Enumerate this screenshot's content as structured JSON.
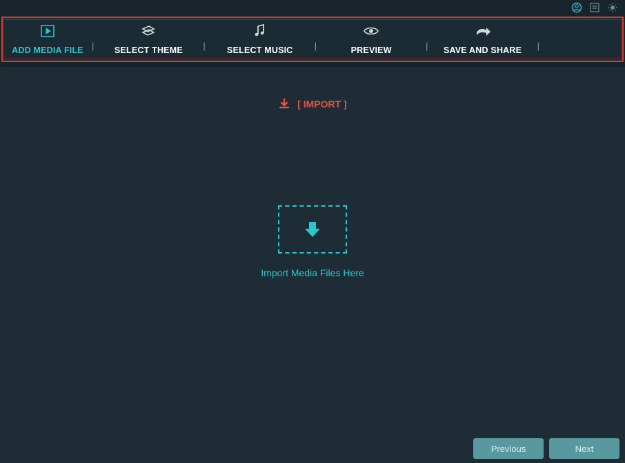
{
  "titlebar": {
    "icons": {
      "user": "user-icon",
      "list": "list-icon",
      "brightness": "brightness-icon"
    }
  },
  "steps": {
    "add_media": "ADD MEDIA FILE",
    "select_theme": "SELECT THEME",
    "select_music": "SELECT MUSIC",
    "preview": "PREVIEW",
    "save_share": "SAVE AND SHARE",
    "divider": "|"
  },
  "import": {
    "label": "[ IMPORT ]"
  },
  "dropzone": {
    "label": "Import Media Files Here"
  },
  "nav": {
    "previous": "Previous",
    "next": "Next"
  },
  "colors": {
    "accent": "#29c6cf",
    "highlight_border": "#d63a2b",
    "import_link": "#df553f",
    "button": "#58999f",
    "bg_dark": "#18242b",
    "bg_work": "#1e2d35"
  }
}
